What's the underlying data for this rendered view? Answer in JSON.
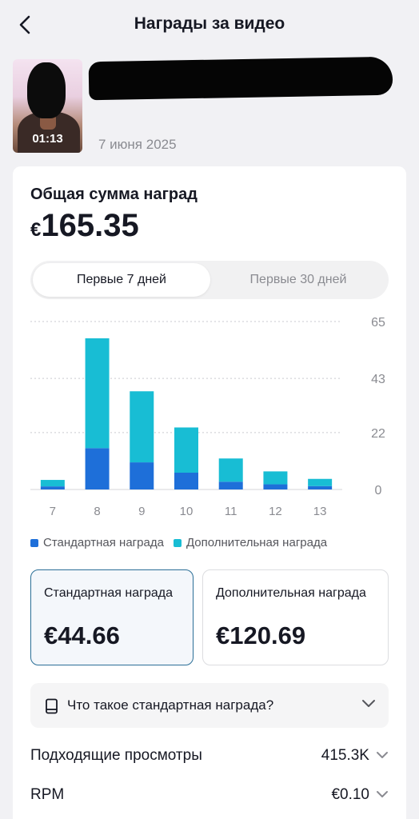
{
  "header": {
    "title": "Награды за видео"
  },
  "video": {
    "duration": "01:13",
    "date": "7 июня 2025"
  },
  "summary": {
    "label": "Общая сумма наград",
    "currency": "€",
    "amount": "165.35"
  },
  "tabs": [
    {
      "label": "Первые 7 дней",
      "active": true
    },
    {
      "label": "Первые 30 дней",
      "active": false
    }
  ],
  "chart_data": {
    "type": "bar",
    "stacked": true,
    "categories": [
      "7",
      "8",
      "9",
      "10",
      "11",
      "12",
      "13"
    ],
    "series": [
      {
        "name": "Стандартная награда",
        "color": "#1e6fd9",
        "values": [
          1.2,
          16,
          10.5,
          6.5,
          3,
          2,
          1.3
        ]
      },
      {
        "name": "Дополнительная награда",
        "color": "#18bdd4",
        "values": [
          2.5,
          42.5,
          27.5,
          17.5,
          9,
          5,
          2.8
        ]
      }
    ],
    "y_ticks": [
      "65",
      "43",
      "22",
      "0"
    ],
    "ylim": [
      0,
      65
    ],
    "grid": true
  },
  "legend": {
    "standard": "Стандартная награда",
    "extra": "Дополнительная награда"
  },
  "rewards": {
    "standard": {
      "label": "Стандартная награда",
      "amount": "€44.66"
    },
    "extra": {
      "label": "Дополнительная награда",
      "amount": "€120.69"
    }
  },
  "faq": {
    "label": "Что такое стандартная награда?"
  },
  "stats": [
    {
      "label": "Подходящие просмотры",
      "value": "415.3K"
    },
    {
      "label": "RPM",
      "value": "€0.10"
    }
  ],
  "icons": {
    "back": "chevron-left-icon",
    "faq": "book-icon",
    "expand": "chevron-down-icon"
  }
}
